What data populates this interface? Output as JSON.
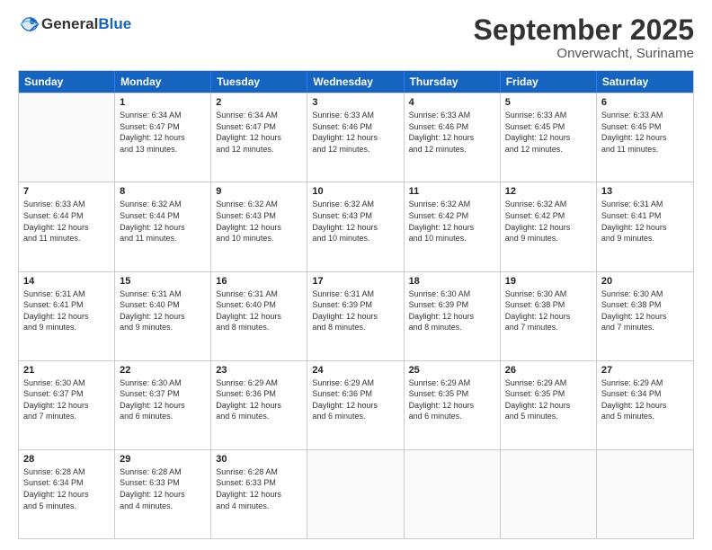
{
  "header": {
    "logo": {
      "general": "General",
      "blue": "Blue"
    },
    "title": "September 2025",
    "location": "Onverwacht, Suriname"
  },
  "calendar": {
    "days_of_week": [
      "Sunday",
      "Monday",
      "Tuesday",
      "Wednesday",
      "Thursday",
      "Friday",
      "Saturday"
    ],
    "weeks": [
      [
        {
          "day": "",
          "info": ""
        },
        {
          "day": "1",
          "info": "Sunrise: 6:34 AM\nSunset: 6:47 PM\nDaylight: 12 hours\nand 13 minutes."
        },
        {
          "day": "2",
          "info": "Sunrise: 6:34 AM\nSunset: 6:47 PM\nDaylight: 12 hours\nand 12 minutes."
        },
        {
          "day": "3",
          "info": "Sunrise: 6:33 AM\nSunset: 6:46 PM\nDaylight: 12 hours\nand 12 minutes."
        },
        {
          "day": "4",
          "info": "Sunrise: 6:33 AM\nSunset: 6:46 PM\nDaylight: 12 hours\nand 12 minutes."
        },
        {
          "day": "5",
          "info": "Sunrise: 6:33 AM\nSunset: 6:45 PM\nDaylight: 12 hours\nand 12 minutes."
        },
        {
          "day": "6",
          "info": "Sunrise: 6:33 AM\nSunset: 6:45 PM\nDaylight: 12 hours\nand 11 minutes."
        }
      ],
      [
        {
          "day": "7",
          "info": "Sunrise: 6:33 AM\nSunset: 6:44 PM\nDaylight: 12 hours\nand 11 minutes."
        },
        {
          "day": "8",
          "info": "Sunrise: 6:32 AM\nSunset: 6:44 PM\nDaylight: 12 hours\nand 11 minutes."
        },
        {
          "day": "9",
          "info": "Sunrise: 6:32 AM\nSunset: 6:43 PM\nDaylight: 12 hours\nand 10 minutes."
        },
        {
          "day": "10",
          "info": "Sunrise: 6:32 AM\nSunset: 6:43 PM\nDaylight: 12 hours\nand 10 minutes."
        },
        {
          "day": "11",
          "info": "Sunrise: 6:32 AM\nSunset: 6:42 PM\nDaylight: 12 hours\nand 10 minutes."
        },
        {
          "day": "12",
          "info": "Sunrise: 6:32 AM\nSunset: 6:42 PM\nDaylight: 12 hours\nand 9 minutes."
        },
        {
          "day": "13",
          "info": "Sunrise: 6:31 AM\nSunset: 6:41 PM\nDaylight: 12 hours\nand 9 minutes."
        }
      ],
      [
        {
          "day": "14",
          "info": "Sunrise: 6:31 AM\nSunset: 6:41 PM\nDaylight: 12 hours\nand 9 minutes."
        },
        {
          "day": "15",
          "info": "Sunrise: 6:31 AM\nSunset: 6:40 PM\nDaylight: 12 hours\nand 9 minutes."
        },
        {
          "day": "16",
          "info": "Sunrise: 6:31 AM\nSunset: 6:40 PM\nDaylight: 12 hours\nand 8 minutes."
        },
        {
          "day": "17",
          "info": "Sunrise: 6:31 AM\nSunset: 6:39 PM\nDaylight: 12 hours\nand 8 minutes."
        },
        {
          "day": "18",
          "info": "Sunrise: 6:30 AM\nSunset: 6:39 PM\nDaylight: 12 hours\nand 8 minutes."
        },
        {
          "day": "19",
          "info": "Sunrise: 6:30 AM\nSunset: 6:38 PM\nDaylight: 12 hours\nand 7 minutes."
        },
        {
          "day": "20",
          "info": "Sunrise: 6:30 AM\nSunset: 6:38 PM\nDaylight: 12 hours\nand 7 minutes."
        }
      ],
      [
        {
          "day": "21",
          "info": "Sunrise: 6:30 AM\nSunset: 6:37 PM\nDaylight: 12 hours\nand 7 minutes."
        },
        {
          "day": "22",
          "info": "Sunrise: 6:30 AM\nSunset: 6:37 PM\nDaylight: 12 hours\nand 6 minutes."
        },
        {
          "day": "23",
          "info": "Sunrise: 6:29 AM\nSunset: 6:36 PM\nDaylight: 12 hours\nand 6 minutes."
        },
        {
          "day": "24",
          "info": "Sunrise: 6:29 AM\nSunset: 6:36 PM\nDaylight: 12 hours\nand 6 minutes."
        },
        {
          "day": "25",
          "info": "Sunrise: 6:29 AM\nSunset: 6:35 PM\nDaylight: 12 hours\nand 6 minutes."
        },
        {
          "day": "26",
          "info": "Sunrise: 6:29 AM\nSunset: 6:35 PM\nDaylight: 12 hours\nand 5 minutes."
        },
        {
          "day": "27",
          "info": "Sunrise: 6:29 AM\nSunset: 6:34 PM\nDaylight: 12 hours\nand 5 minutes."
        }
      ],
      [
        {
          "day": "28",
          "info": "Sunrise: 6:28 AM\nSunset: 6:34 PM\nDaylight: 12 hours\nand 5 minutes."
        },
        {
          "day": "29",
          "info": "Sunrise: 6:28 AM\nSunset: 6:33 PM\nDaylight: 12 hours\nand 4 minutes."
        },
        {
          "day": "30",
          "info": "Sunrise: 6:28 AM\nSunset: 6:33 PM\nDaylight: 12 hours\nand 4 minutes."
        },
        {
          "day": "",
          "info": ""
        },
        {
          "day": "",
          "info": ""
        },
        {
          "day": "",
          "info": ""
        },
        {
          "day": "",
          "info": ""
        }
      ]
    ]
  }
}
